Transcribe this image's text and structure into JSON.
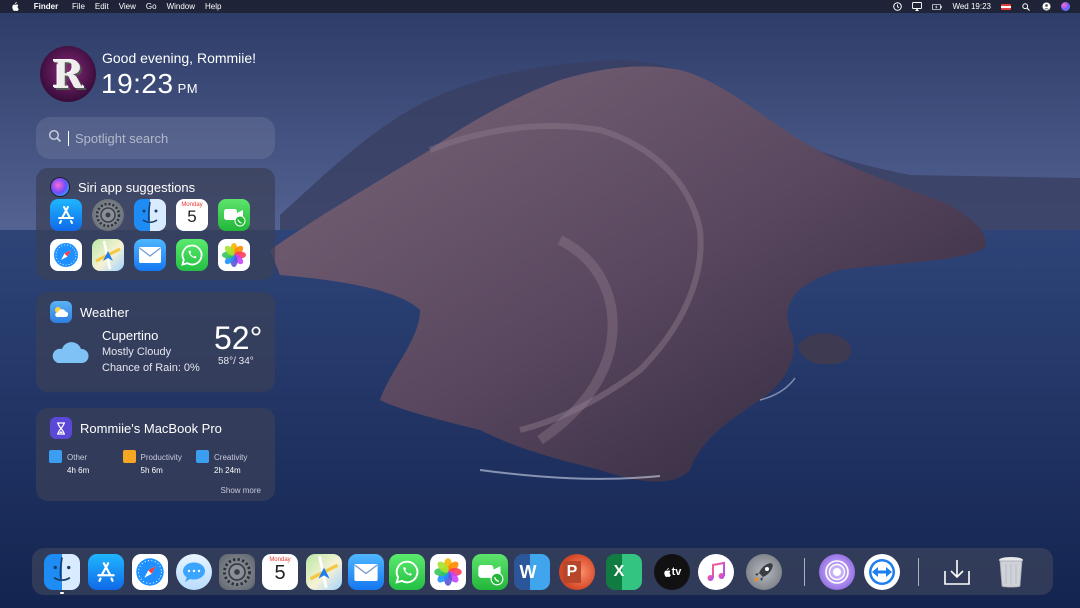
{
  "menubar": {
    "app_name": "Finder",
    "menus": [
      "File",
      "Edit",
      "View",
      "Go",
      "Window",
      "Help"
    ],
    "clock": "Wed 19:23"
  },
  "greeting": {
    "avatar_letter": "R",
    "message": "Good evening, Rommiie!",
    "time": "19:23",
    "ampm": "PM"
  },
  "search": {
    "placeholder": "Spotlight search"
  },
  "siri": {
    "title": "Siri app suggestions",
    "apps": [
      "app-store",
      "system-preferences",
      "finder",
      "calendar",
      "facetime",
      "safari",
      "maps",
      "mail",
      "whatsapp",
      "photos"
    ],
    "calendar_month": "Monday",
    "calendar_day": "5"
  },
  "weather": {
    "title": "Weather",
    "city": "Cupertino",
    "condition": "Mostly Cloudy",
    "rain": "Chance of Rain: 0%",
    "temp": "52°",
    "hilo": "58°/ 34°"
  },
  "screentime": {
    "title": "Rommiie's MacBook Pro",
    "categories": [
      {
        "name": "Other",
        "time": "4h 6m",
        "color": "#3b9ef0"
      },
      {
        "name": "Productivity",
        "time": "5h 6m",
        "color": "#f5a623"
      },
      {
        "name": "Creativity",
        "time": "2h 24m",
        "color": "#3b9ef0"
      }
    ],
    "show_more": "Show more"
  },
  "dock": {
    "calendar_month": "Monday",
    "calendar_day": "5",
    "word_letter": "W",
    "ppt_letter": "P",
    "excel_letter": "X",
    "tv_label": "tv",
    "items": [
      "finder",
      "app-store",
      "safari",
      "messages",
      "system-preferences",
      "calendar",
      "maps",
      "mail",
      "whatsapp",
      "photos",
      "facetime",
      "word",
      "powerpoint",
      "excel",
      "apple-tv",
      "music",
      "launchpad",
      "tor-browser",
      "teamviewer",
      "downloads",
      "trash"
    ]
  },
  "colors": {
    "accent": "#3b9ef0",
    "productivity": "#f5a623",
    "screentime": "#5b48d6"
  }
}
